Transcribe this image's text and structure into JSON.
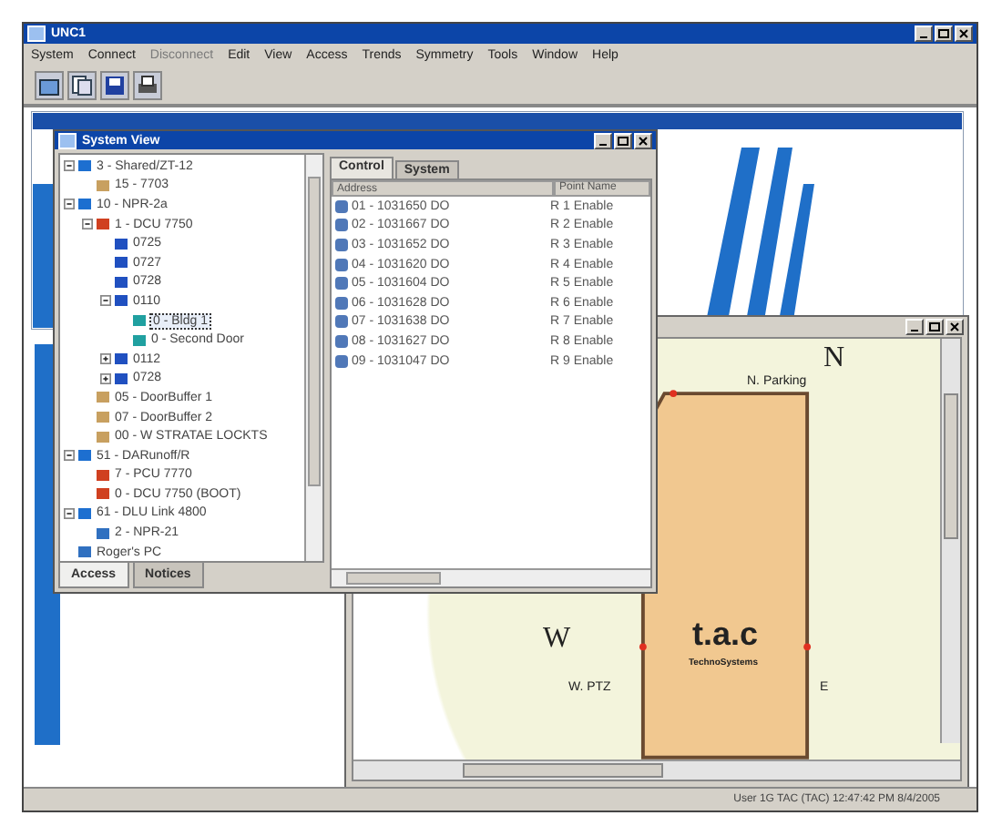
{
  "window": {
    "title": "UNC1"
  },
  "menu": [
    {
      "label": "System",
      "disabled": false
    },
    {
      "label": "Connect",
      "disabled": false
    },
    {
      "label": "Disconnect",
      "disabled": true
    },
    {
      "label": "Edit",
      "disabled": false
    },
    {
      "label": "View",
      "disabled": false
    },
    {
      "label": "Access",
      "disabled": false
    },
    {
      "label": "Trends",
      "disabled": false
    },
    {
      "label": "Symmetry",
      "disabled": false
    },
    {
      "label": "Tools",
      "disabled": false
    },
    {
      "label": "Window",
      "disabled": false
    },
    {
      "label": "Help",
      "disabled": false
    }
  ],
  "toolbar": [
    {
      "kind": "open"
    },
    {
      "kind": "copy"
    },
    {
      "kind": "save"
    },
    {
      "kind": "print"
    }
  ],
  "system_view": {
    "title": "System View",
    "tree": [
      {
        "label": "3 - Shared/ZT-12",
        "kind": "site",
        "expanded": true,
        "selected": false,
        "children": [
          {
            "label": "15 - 7703",
            "kind": "panel",
            "selected": false
          }
        ]
      },
      {
        "label": "10 - NPR-2a",
        "kind": "site",
        "expanded": true,
        "selected": false,
        "children": [
          {
            "label": "1 - DCU 7750",
            "kind": "controller",
            "expanded": true,
            "selected": false,
            "children": [
              {
                "label": "0725",
                "kind": "door",
                "selected": false
              },
              {
                "label": "0727",
                "kind": "door",
                "selected": false
              },
              {
                "label": "0728",
                "kind": "door",
                "selected": false
              },
              {
                "label": "0110",
                "kind": "door",
                "expanded": true,
                "selected": false,
                "children": [
                  {
                    "label": "0 - Bldg 1",
                    "kind": "reader",
                    "selected": true
                  },
                  {
                    "label": "0 - Second Door",
                    "kind": "reader",
                    "selected": false
                  }
                ]
              },
              {
                "label": "0112",
                "kind": "door",
                "expanded": false,
                "selected": false
              },
              {
                "label": "0728",
                "kind": "door",
                "expanded": false,
                "selected": false
              }
            ]
          },
          {
            "label": "05 - DoorBuffer 1",
            "kind": "panel",
            "selected": false
          },
          {
            "label": "07 - DoorBuffer 2",
            "kind": "panel",
            "selected": false
          },
          {
            "label": "00 - W STRATAE LOCKTS",
            "kind": "panel",
            "selected": false
          }
        ]
      },
      {
        "label": "51 - DARunoff/R",
        "kind": "site",
        "expanded": true,
        "selected": false,
        "children": [
          {
            "label": "7 - PCU 7770",
            "kind": "controller",
            "selected": false
          },
          {
            "label": "0 - DCU 7750 (BOOT)",
            "kind": "controller",
            "selected": false
          }
        ]
      },
      {
        "label": "61 - DLU Link 4800",
        "kind": "site",
        "expanded": true,
        "selected": false,
        "children": [
          {
            "label": "2 - NPR-21",
            "kind": "computer",
            "selected": false
          }
        ]
      },
      {
        "label": "Roger's PC",
        "kind": "computer",
        "selected": false
      }
    ],
    "bottom_tabs": [
      {
        "label": "Access",
        "selected": true
      },
      {
        "label": "Notices",
        "selected": false
      }
    ],
    "tabs": [
      {
        "label": "Control",
        "selected": true
      },
      {
        "label": "System",
        "selected": false
      }
    ],
    "columns": [
      "Address",
      "Point Name"
    ],
    "rows": [
      {
        "address": "01 - 1031650 DO",
        "point": "R 1 Enable"
      },
      {
        "address": "02 - 1031667 DO",
        "point": "R 2 Enable"
      },
      {
        "address": "03 - 1031652 DO",
        "point": "R 3 Enable"
      },
      {
        "address": "04 - 1031620 DO",
        "point": "R 4 Enable"
      },
      {
        "address": "05 - 1031604 DO",
        "point": "R 5 Enable"
      },
      {
        "address": "06 - 1031628 DO",
        "point": "R 6 Enable"
      },
      {
        "address": "07 - 1031638 DO",
        "point": "R 7 Enable"
      },
      {
        "address": "08 - 1031627 DO",
        "point": "R 8 Enable"
      },
      {
        "address": "09 - 1031047 DO",
        "point": "R 9 Enable"
      }
    ]
  },
  "map": {
    "north": "N",
    "west": "W",
    "parking": "N. Parking",
    "ptz": "W. PTZ",
    "east": "E",
    "logo": "t.a.c",
    "logo_sub": "TechnoSystems"
  },
  "status_bar": "User 1G TAC (TAC)  12:47:42 PM  8/4/2005"
}
